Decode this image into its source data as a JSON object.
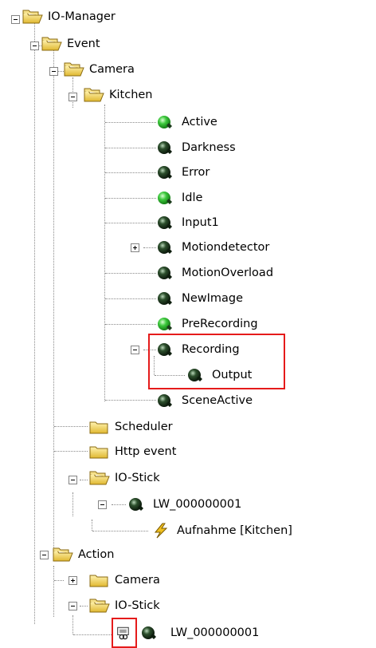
{
  "tree": {
    "root": "IO-Manager",
    "event": {
      "label": "Event",
      "camera": {
        "label": "Camera",
        "kitchen": {
          "label": "Kitchen",
          "items": {
            "active": "Active",
            "darkness": "Darkness",
            "error": "Error",
            "idle": "Idle",
            "input1": "Input1",
            "motiondetector": "Motiondetector",
            "motionoverload": "MotionOverload",
            "newimage": "NewImage",
            "prerecording": "PreRecording",
            "recording": "Recording",
            "output": "Output",
            "sceneactive": "SceneActive"
          }
        }
      },
      "scheduler": "Scheduler",
      "http_event": "Http event",
      "io_stick": {
        "label": "IO-Stick",
        "device": "LW_000000001",
        "aufnahme": "Aufnahme [Kitchen]"
      }
    },
    "action": {
      "label": "Action",
      "camera": "Camera",
      "io_stick": "IO-Stick",
      "device": "LW_000000001"
    }
  },
  "colors": {
    "highlight": "#e51b1b",
    "status_green": "#2fb52f",
    "status_dark": "#1f3f1f",
    "folder": "#f0d060"
  },
  "icons": {
    "folder": "folder-open-icon",
    "green_ball": "status-green-ball-icon",
    "dark_ball": "status-dark-ball-icon",
    "lightning": "lightning-icon",
    "link_device": "linked-device-icon"
  }
}
